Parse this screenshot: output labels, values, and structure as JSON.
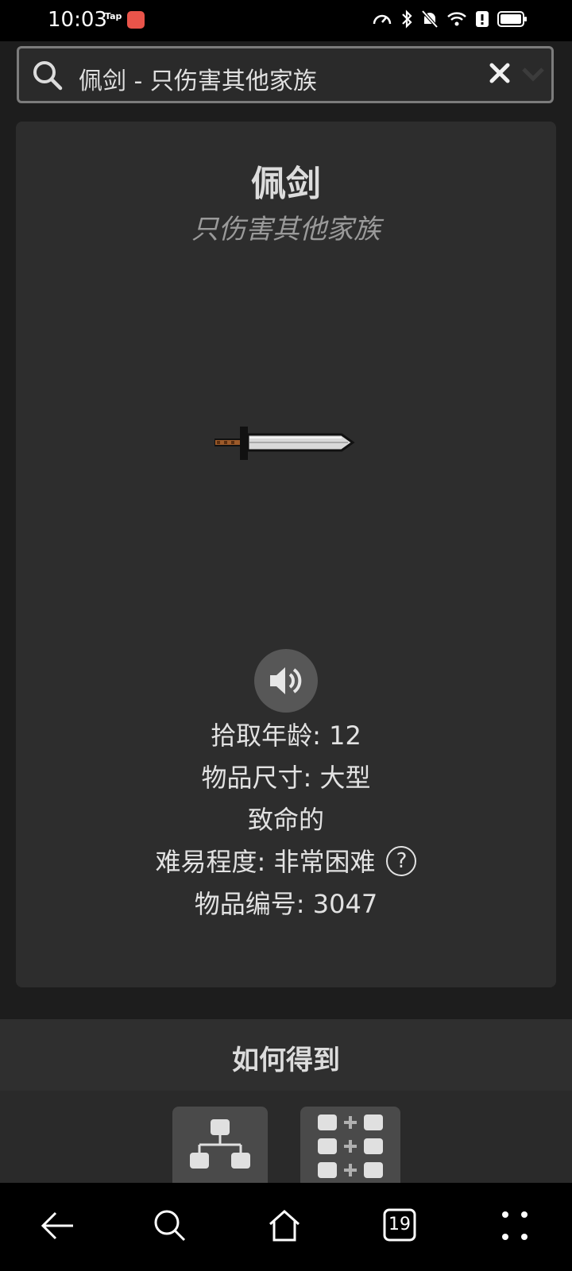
{
  "status_bar": {
    "time": "10:03",
    "tap_badge": "Tap"
  },
  "search": {
    "value": "佩剑 - 只伤害其他家族"
  },
  "item": {
    "name": "佩剑",
    "subtitle": "只伤害其他家族",
    "image_icon": "sword-icon",
    "info": {
      "pickup_age": "拾取年龄: 12",
      "size": "物品尺寸: 大型",
      "deadly": "致命的",
      "difficulty": "难易程度: 非常困难",
      "item_id": "物品编号: 3047"
    },
    "help_glyph": "?"
  },
  "how_to_get": {
    "title": "如何得到",
    "buttons": [
      "tree-icon",
      "recipe-grid-icon"
    ]
  },
  "nav": {
    "tab_count": "19",
    "items": [
      "back-icon",
      "search-icon",
      "home-icon",
      "tabs-icon",
      "menu-icon"
    ]
  },
  "colors": {
    "background": "#1d1d1d",
    "card": "#2d2d2d",
    "text": "#e2e2e2",
    "subtitle": "#9a9a9a"
  }
}
